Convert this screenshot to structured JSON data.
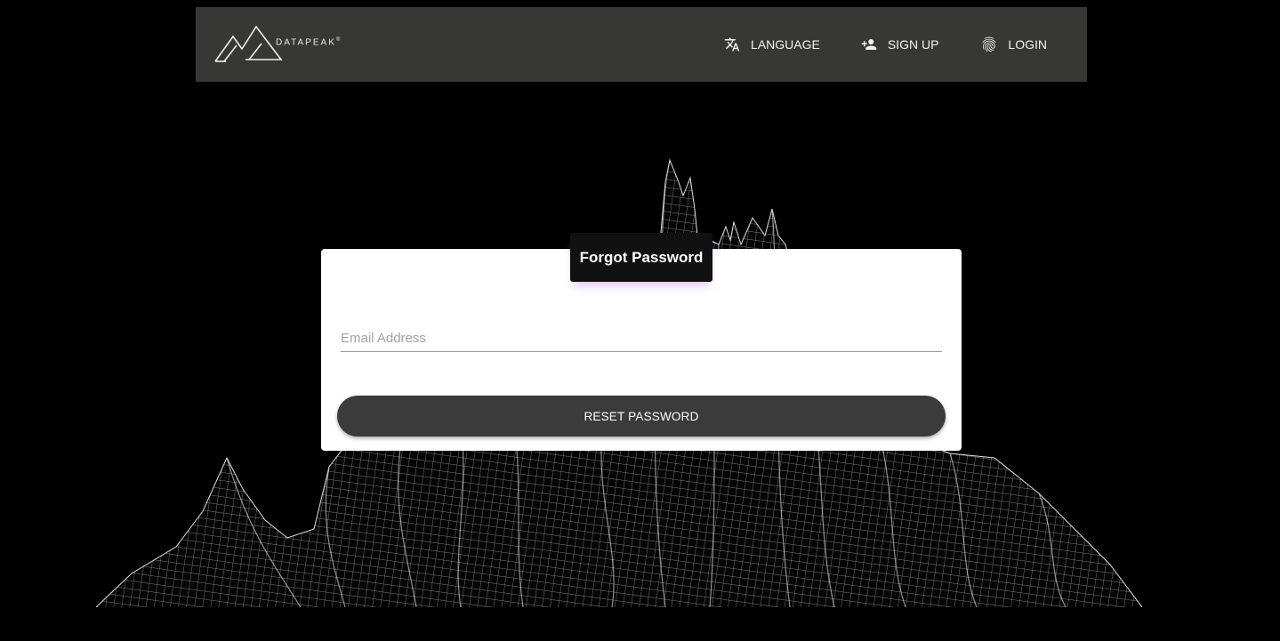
{
  "header": {
    "logo_text": "DATAPEAK",
    "logo_mark": "®",
    "nav": {
      "language": "LANGUAGE",
      "sign_up": "SIGN UP",
      "login": "LOGIN"
    }
  },
  "form": {
    "title": "Forgot Password",
    "email_placeholder": "Email Address",
    "email_value": "",
    "reset_label": "RESET PASSWORD"
  },
  "colors": {
    "page_bg": "#000000",
    "header_bg": "#373836",
    "card_bg": "#ffffff",
    "button_bg": "#3b3b3b",
    "title_bg": "#111111"
  },
  "icons": {
    "language": "translate-icon",
    "sign_up": "person-add-icon",
    "login": "fingerprint-icon"
  }
}
